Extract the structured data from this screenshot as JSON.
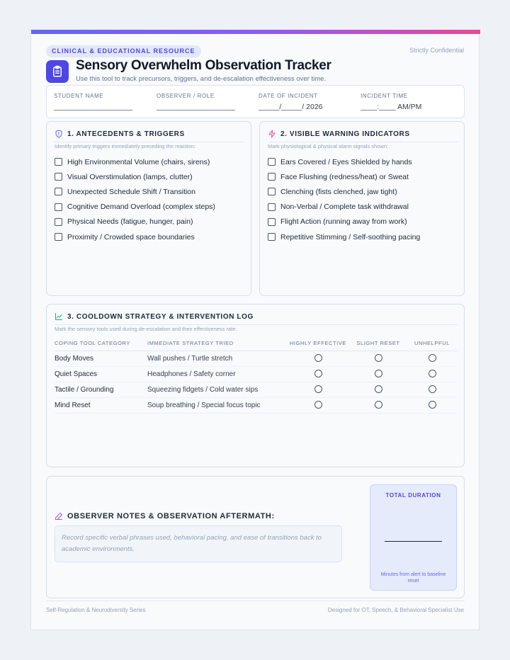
{
  "header": {
    "pill": "CLINICAL & EDUCATIONAL RESOURCE",
    "confidential": "Strictly Confidential",
    "title": "Sensory Overwhelm Observation Tracker",
    "subtitle": "Use this tool to track precursors, triggers, and de-escalation effectiveness over time.",
    "logo_icon": "clipboard-icon"
  },
  "info": [
    {
      "label": "STUDENT NAME",
      "value": "___________________"
    },
    {
      "label": "OBSERVER / ROLE",
      "value": "___________________"
    },
    {
      "label": "DATE OF INCIDENT",
      "value": "_____/_____/ 2026"
    },
    {
      "label": "INCIDENT TIME",
      "value": "____:____ AM/PM"
    }
  ],
  "antecedents": {
    "title": "1. ANTECEDENTS & TRIGGERS",
    "subtitle": "Identify primary triggers immediately preceding the reaction:",
    "icon": "shield-icon",
    "items": [
      "High Environmental Volume (chairs, sirens)",
      "Visual Overstimulation (lamps, clutter)",
      "Unexpected Schedule Shift / Transition",
      "Cognitive Demand Overload (complex steps)",
      "Physical Needs (fatigue, hunger, pain)",
      "Proximity / Crowded space boundaries"
    ]
  },
  "warnings": {
    "title": "2. VISIBLE WARNING INDICATORS",
    "subtitle": "Mark physiological & physical alarm signals shown:",
    "icon": "lightning-icon",
    "items": [
      "Ears Covered / Eyes Shielded by hands",
      "Face Flushing (redness/heat) or Sweat",
      "Clenching (fists clenched, jaw tight)",
      "Non-Verbal / Complete task withdrawal",
      "Flight Action (running away from work)",
      "Repetitive Stimming / Self-soothing pacing"
    ]
  },
  "cooldown": {
    "title": "3. COOLDOWN STRATEGY & INTERVENTION LOG",
    "subtitle": "Mark the sensory tools used during de-escalation and their effectiveness rate:",
    "icon": "chart-line-icon",
    "columns": [
      "COPING TOOL CATEGORY",
      "IMMEDIATE STRATEGY TRIED",
      "HIGHLY EFFECTIVE",
      "SLIGHT RESET",
      "UNHELPFUL"
    ],
    "rows": [
      {
        "category": "Body Moves",
        "strategy": "Wall pushes / Turtle stretch"
      },
      {
        "category": "Quiet Spaces",
        "strategy": "Headphones / Safety corner"
      },
      {
        "category": "Tactile / Grounding",
        "strategy": "Squeezing fidgets / Cold water sips"
      },
      {
        "category": "Mind Reset",
        "strategy": "Soup breathing / Special focus topic"
      }
    ]
  },
  "notes": {
    "title": "OBSERVER NOTES & OBSERVATION AFTERMATH:",
    "placeholder": "Record specific verbal phrases used, behavioral pacing, and ease of transitions back to academic environments.",
    "icon": "pencil-icon"
  },
  "duration": {
    "title": "TOTAL DURATION",
    "caption": "Minutes from alert to baseline reset"
  },
  "footer": {
    "left": "Self-Regulation & Neurodiversity Series",
    "right": "Designed for OT, Speech, & Behavioral Specialist Use"
  },
  "colors": {
    "accent": "#4f46e5",
    "gradient_start": "#6366f1",
    "gradient_end": "#ec4899",
    "warning_icon": "#ec4899",
    "chart_icon": "#10b981"
  }
}
